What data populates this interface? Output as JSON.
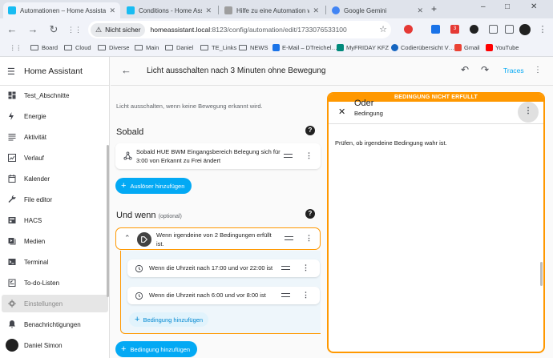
{
  "browser": {
    "tabs": [
      {
        "title": "Automationen – Home Assistant",
        "color": "#18bcf2"
      },
      {
        "title": "Conditions - Home Assistant",
        "color": "#18bcf2"
      },
      {
        "title": "Hilfe zu eine Automation wa…",
        "color": "#9e9e9e"
      },
      {
        "title": "Google Gemini",
        "color": "#4285f4"
      }
    ],
    "new_tab": "+",
    "window_controls": [
      "–",
      "□",
      "✕"
    ],
    "nav": {
      "back": "←",
      "forward": "→",
      "reload": "↻",
      "apps": "⋮⋮"
    },
    "secure_chip": "Nicht sicher",
    "url_host": "homeassistant.local",
    "url_rest": ":8123/config/automation/edit/1733076533100",
    "bookmarks": [
      "Board",
      "Cloud",
      "Diverse",
      "Main",
      "Daniel",
      "TE_Links",
      "NEWS",
      "E-Mail – DTreichel…",
      "MyFRIDAY KFZ",
      "Codierübersicht V…",
      "Gmail",
      "YouTube"
    ],
    "extension_badge": "3"
  },
  "sidebar": {
    "title": "Home Assistant",
    "items": [
      {
        "label": "Test_Abschnitte",
        "icon": "dashboard-icon"
      },
      {
        "label": "Energie",
        "icon": "lightning-icon"
      },
      {
        "label": "Aktivität",
        "icon": "list-icon"
      },
      {
        "label": "Verlauf",
        "icon": "chart-icon"
      },
      {
        "label": "Kalender",
        "icon": "calendar-icon"
      },
      {
        "label": "File editor",
        "icon": "wrench-icon"
      },
      {
        "label": "HACS",
        "icon": "hacs-icon"
      },
      {
        "label": "Medien",
        "icon": "media-icon"
      },
      {
        "label": "Terminal",
        "icon": "terminal-icon"
      },
      {
        "label": "To-do-Listen",
        "icon": "todo-icon"
      },
      {
        "label": "Einstellungen",
        "icon": "cog-icon"
      },
      {
        "label": "Benachrichtigungen",
        "icon": "bell-icon"
      }
    ],
    "user": "Daniel Simon"
  },
  "topbar": {
    "title": "Licht ausschalten nach 3 Minuten ohne Bewegung",
    "traces": "Traces"
  },
  "editor": {
    "description": "Licht ausschalten, wenn keine Bewegung erkannt wird.",
    "trigger_heading": "Sobald",
    "help": "?",
    "trigger_text": "Sobald HUE BWM Eingangsbereich Belegung sich für 3:00 von Erkannt zu Frei ändert",
    "add_trigger": "Auslöser hinzufügen",
    "condition_heading": "Und wenn",
    "condition_optional": "(optional)",
    "or_condition_text": "Wenn irgendeine von 2 Bedingungen erfüllt ist.",
    "sub_conditions": [
      "Wenn die Uhrzeit nach 17:00 und vor 22:00 ist",
      "Wenn die Uhrzeit nach 6:00 und vor 8:00 ist"
    ],
    "add_sub_condition": "Bedingung hinzufügen",
    "add_condition": "Bedingung hinzufügen"
  },
  "dialog": {
    "banner": "BEDINGUNG NICHT ERFÜLLT",
    "title": "Oder",
    "subtitle": "Bedingung",
    "body": "Prüfen, ob irgendeine Bedingung wahr ist."
  },
  "colors": {
    "accent": "#03a9f4",
    "warning": "#ff9800"
  }
}
